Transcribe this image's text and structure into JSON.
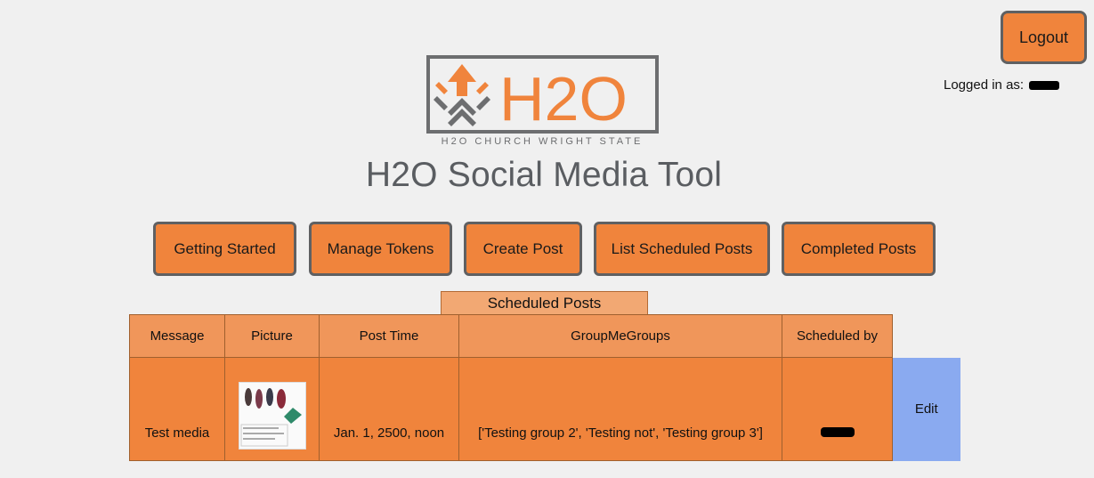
{
  "header": {
    "logout_label": "Logout",
    "logged_in_prefix": "Logged in as:",
    "logo_text": "H2O",
    "logo_subtitle": "H2O CHURCH WRIGHT STATE",
    "title": "H2O Social Media Tool"
  },
  "nav": {
    "items": [
      {
        "label": "Getting Started"
      },
      {
        "label": "Manage Tokens"
      },
      {
        "label": "Create Post"
      },
      {
        "label": "List Scheduled Posts"
      },
      {
        "label": "Completed Posts"
      }
    ]
  },
  "table": {
    "caption": "Scheduled Posts",
    "columns": [
      "Message",
      "Picture",
      "Post Time",
      "GroupMeGroups",
      "Scheduled by"
    ],
    "rows": [
      {
        "message": "Test media",
        "post_time": "Jan. 1, 2500, noon",
        "groups": "['Testing group 2', 'Testing not', 'Testing group 3']",
        "edit_label": "Edit"
      }
    ]
  },
  "colors": {
    "accent": "#f0843c",
    "border": "#5f6062",
    "edit": "#8aaaf0",
    "background": "#f0f0f0"
  }
}
